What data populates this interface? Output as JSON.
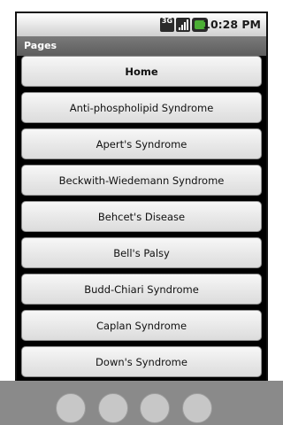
{
  "status_bar": {
    "network_label": "3G",
    "time": "10:28 PM"
  },
  "title_bar": {
    "title": "Pages"
  },
  "pages": [
    {
      "label": "Home",
      "bold": true
    },
    {
      "label": "Anti-phospholipid Syndrome"
    },
    {
      "label": "Apert's Syndrome"
    },
    {
      "label": "Beckwith-Wiedemann Syndrome"
    },
    {
      "label": "Behcet's Disease"
    },
    {
      "label": "Bell's Palsy"
    },
    {
      "label": "Budd-Chiari Syndrome"
    },
    {
      "label": "Caplan Syndrome"
    },
    {
      "label": "Down's Syndrome"
    }
  ],
  "icons": {
    "network": "3g-icon",
    "signal": "signal-strength-icon",
    "battery": "battery-icon"
  }
}
